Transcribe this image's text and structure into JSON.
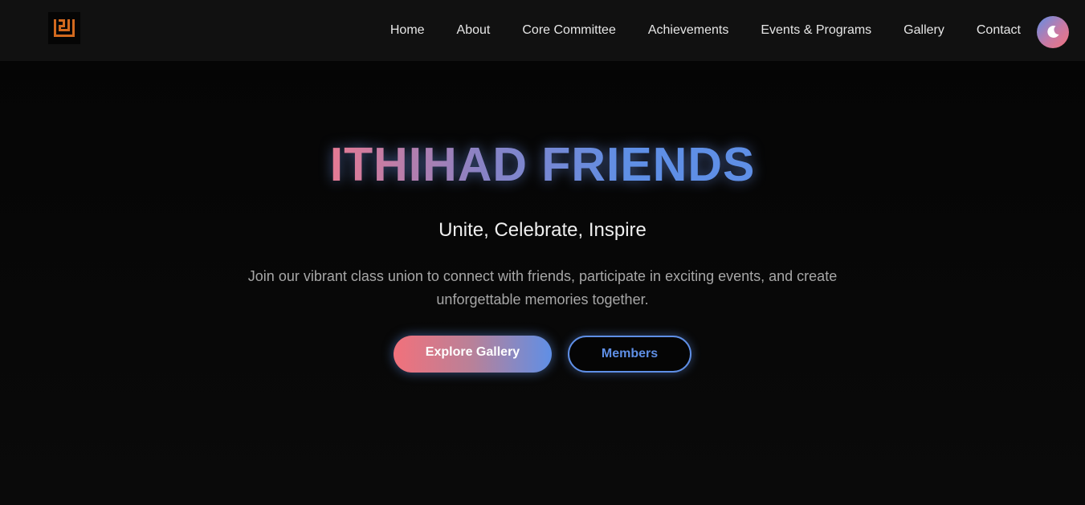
{
  "nav": {
    "logo_icon": "kufic-logo-icon",
    "items": [
      {
        "label": "Home"
      },
      {
        "label": "About"
      },
      {
        "label": "Core Committee"
      },
      {
        "label": "Achievements"
      },
      {
        "label": "Events & Programs"
      },
      {
        "label": "Gallery"
      },
      {
        "label": "Contact"
      }
    ],
    "theme_toggle_icon": "moon-icon"
  },
  "hero": {
    "title": "ITHIHAD FRIENDS",
    "subtitle": "Unite, Celebrate, Inspire",
    "description": "Join our vibrant class union to connect with friends, participate in exciting events, and create unforgettable memories together.",
    "primary_button": "Explore Gallery",
    "secondary_button": "Members"
  },
  "colors": {
    "background": "#0a0a0a",
    "navbar": "#111111",
    "accent_blue": "#5f8fe6",
    "accent_pink": "#f2717b",
    "logo_orange": "#d2691e"
  }
}
